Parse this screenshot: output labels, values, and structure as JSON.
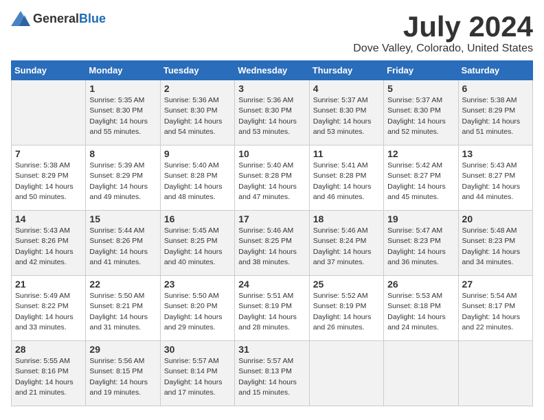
{
  "header": {
    "logo_general": "General",
    "logo_blue": "Blue",
    "month": "July 2024",
    "location": "Dove Valley, Colorado, United States"
  },
  "calendar": {
    "days_of_week": [
      "Sunday",
      "Monday",
      "Tuesday",
      "Wednesday",
      "Thursday",
      "Friday",
      "Saturday"
    ],
    "weeks": [
      [
        {
          "day": "",
          "info": ""
        },
        {
          "day": "1",
          "info": "Sunrise: 5:35 AM\nSunset: 8:30 PM\nDaylight: 14 hours\nand 55 minutes."
        },
        {
          "day": "2",
          "info": "Sunrise: 5:36 AM\nSunset: 8:30 PM\nDaylight: 14 hours\nand 54 minutes."
        },
        {
          "day": "3",
          "info": "Sunrise: 5:36 AM\nSunset: 8:30 PM\nDaylight: 14 hours\nand 53 minutes."
        },
        {
          "day": "4",
          "info": "Sunrise: 5:37 AM\nSunset: 8:30 PM\nDaylight: 14 hours\nand 53 minutes."
        },
        {
          "day": "5",
          "info": "Sunrise: 5:37 AM\nSunset: 8:30 PM\nDaylight: 14 hours\nand 52 minutes."
        },
        {
          "day": "6",
          "info": "Sunrise: 5:38 AM\nSunset: 8:29 PM\nDaylight: 14 hours\nand 51 minutes."
        }
      ],
      [
        {
          "day": "7",
          "info": "Sunrise: 5:38 AM\nSunset: 8:29 PM\nDaylight: 14 hours\nand 50 minutes."
        },
        {
          "day": "8",
          "info": "Sunrise: 5:39 AM\nSunset: 8:29 PM\nDaylight: 14 hours\nand 49 minutes."
        },
        {
          "day": "9",
          "info": "Sunrise: 5:40 AM\nSunset: 8:28 PM\nDaylight: 14 hours\nand 48 minutes."
        },
        {
          "day": "10",
          "info": "Sunrise: 5:40 AM\nSunset: 8:28 PM\nDaylight: 14 hours\nand 47 minutes."
        },
        {
          "day": "11",
          "info": "Sunrise: 5:41 AM\nSunset: 8:28 PM\nDaylight: 14 hours\nand 46 minutes."
        },
        {
          "day": "12",
          "info": "Sunrise: 5:42 AM\nSunset: 8:27 PM\nDaylight: 14 hours\nand 45 minutes."
        },
        {
          "day": "13",
          "info": "Sunrise: 5:43 AM\nSunset: 8:27 PM\nDaylight: 14 hours\nand 44 minutes."
        }
      ],
      [
        {
          "day": "14",
          "info": "Sunrise: 5:43 AM\nSunset: 8:26 PM\nDaylight: 14 hours\nand 42 minutes."
        },
        {
          "day": "15",
          "info": "Sunrise: 5:44 AM\nSunset: 8:26 PM\nDaylight: 14 hours\nand 41 minutes."
        },
        {
          "day": "16",
          "info": "Sunrise: 5:45 AM\nSunset: 8:25 PM\nDaylight: 14 hours\nand 40 minutes."
        },
        {
          "day": "17",
          "info": "Sunrise: 5:46 AM\nSunset: 8:25 PM\nDaylight: 14 hours\nand 38 minutes."
        },
        {
          "day": "18",
          "info": "Sunrise: 5:46 AM\nSunset: 8:24 PM\nDaylight: 14 hours\nand 37 minutes."
        },
        {
          "day": "19",
          "info": "Sunrise: 5:47 AM\nSunset: 8:23 PM\nDaylight: 14 hours\nand 36 minutes."
        },
        {
          "day": "20",
          "info": "Sunrise: 5:48 AM\nSunset: 8:23 PM\nDaylight: 14 hours\nand 34 minutes."
        }
      ],
      [
        {
          "day": "21",
          "info": "Sunrise: 5:49 AM\nSunset: 8:22 PM\nDaylight: 14 hours\nand 33 minutes."
        },
        {
          "day": "22",
          "info": "Sunrise: 5:50 AM\nSunset: 8:21 PM\nDaylight: 14 hours\nand 31 minutes."
        },
        {
          "day": "23",
          "info": "Sunrise: 5:50 AM\nSunset: 8:20 PM\nDaylight: 14 hours\nand 29 minutes."
        },
        {
          "day": "24",
          "info": "Sunrise: 5:51 AM\nSunset: 8:19 PM\nDaylight: 14 hours\nand 28 minutes."
        },
        {
          "day": "25",
          "info": "Sunrise: 5:52 AM\nSunset: 8:19 PM\nDaylight: 14 hours\nand 26 minutes."
        },
        {
          "day": "26",
          "info": "Sunrise: 5:53 AM\nSunset: 8:18 PM\nDaylight: 14 hours\nand 24 minutes."
        },
        {
          "day": "27",
          "info": "Sunrise: 5:54 AM\nSunset: 8:17 PM\nDaylight: 14 hours\nand 22 minutes."
        }
      ],
      [
        {
          "day": "28",
          "info": "Sunrise: 5:55 AM\nSunset: 8:16 PM\nDaylight: 14 hours\nand 21 minutes."
        },
        {
          "day": "29",
          "info": "Sunrise: 5:56 AM\nSunset: 8:15 PM\nDaylight: 14 hours\nand 19 minutes."
        },
        {
          "day": "30",
          "info": "Sunrise: 5:57 AM\nSunset: 8:14 PM\nDaylight: 14 hours\nand 17 minutes."
        },
        {
          "day": "31",
          "info": "Sunrise: 5:57 AM\nSunset: 8:13 PM\nDaylight: 14 hours\nand 15 minutes."
        },
        {
          "day": "",
          "info": ""
        },
        {
          "day": "",
          "info": ""
        },
        {
          "day": "",
          "info": ""
        }
      ]
    ]
  }
}
